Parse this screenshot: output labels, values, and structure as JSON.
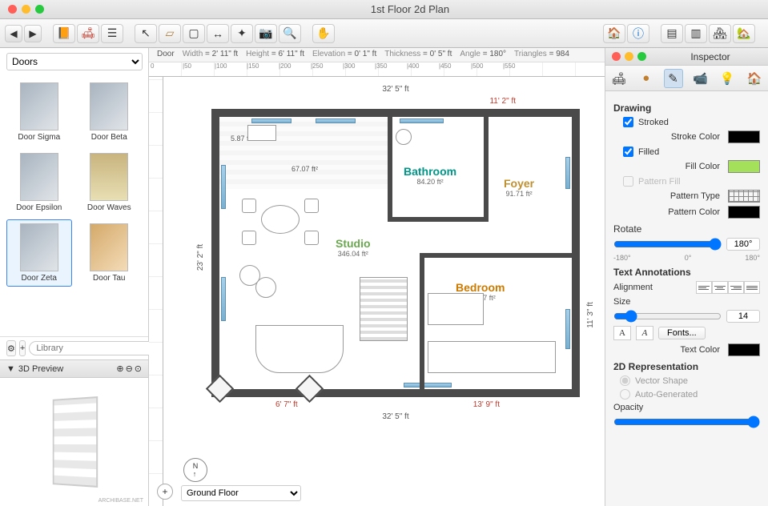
{
  "title": "1st Floor 2d Plan",
  "library": {
    "category": "Doors",
    "search_placeholder": "Library",
    "items": [
      "Door Sigma",
      "Door Beta",
      "Door Epsilon",
      "Door Waves",
      "Door Zeta",
      "Door Tau"
    ],
    "selected_index": 4,
    "preview_title": "3D Preview",
    "preview_logo": "ARCHIBASE.NET"
  },
  "info": {
    "object": "Door",
    "width": "2' 11\" ft",
    "height": "6' 11\" ft",
    "elevation": "0' 1\" ft",
    "thickness": "0' 5\" ft",
    "angle": "180°",
    "triangles": "984",
    "width_label": "Width",
    "height_label": "Height",
    "elevation_label": "Elevation",
    "thickness_label": "Thickness",
    "angle_label": "Angle",
    "triangles_label": "Triangles"
  },
  "plan": {
    "outer_w": "32' 5\" ft",
    "outer_w2": "32' 5\" ft",
    "outer_h": "23' 2\" ft",
    "top_red": "11' 2\" ft",
    "bottom_red_l": "6' 7\" ft",
    "bottom_red_r": "13' 9\" ft",
    "right_dim": "11' 3\" ft",
    "kitchen_note": "5.87 ft²",
    "hall_area": "67.07 ft²",
    "rooms": {
      "bathroom": {
        "name": "Bathroom",
        "area": "84.20 ft²"
      },
      "foyer": {
        "name": "Foyer",
        "area": "91.71 ft²"
      },
      "studio": {
        "name": "Studio",
        "area": "346.04 ft²"
      },
      "bedroom": {
        "name": "Bedroom",
        "area": "152.77 ft²"
      }
    },
    "floor_selector": "Ground Floor"
  },
  "inspector": {
    "title": "Inspector",
    "drawing": "Drawing",
    "stroked": "Stroked",
    "stroke_color": "Stroke Color",
    "filled": "Filled",
    "fill_color": "Fill Color",
    "pattern_fill": "Pattern Fill",
    "pattern_type": "Pattern Type",
    "pattern_color": "Pattern Color",
    "rotate": "Rotate",
    "rotate_val": "180°",
    "rotate_min": "-180°",
    "rotate_mid": "0°",
    "rotate_max": "180°",
    "text_ann": "Text Annotations",
    "alignment": "Alignment",
    "size": "Size",
    "size_val": "14",
    "fonts": "Fonts...",
    "text_color": "Text Color",
    "repr": "2D Representation",
    "vector": "Vector Shape",
    "auto": "Auto-Generated",
    "opacity": "Opacity"
  },
  "ruler": [
    "0",
    "|50",
    "|100",
    "|150",
    "|200",
    "|250",
    "|300",
    "|350",
    "|400",
    "|450",
    "|500",
    "|550"
  ]
}
